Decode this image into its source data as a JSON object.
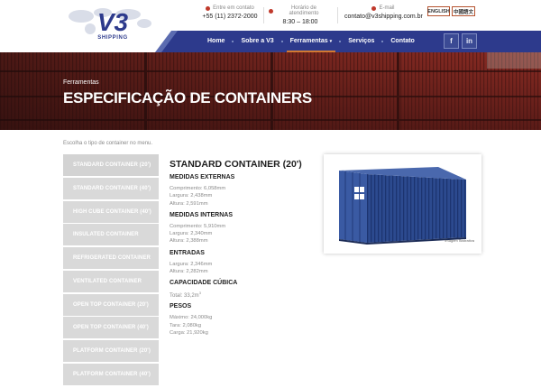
{
  "header": {
    "logo_text": "V3",
    "logo_subtext": "SHIPPING",
    "contact": {
      "label": "Entre em contato",
      "value": "+55 (11) 2372-2000"
    },
    "hours": {
      "label": "Horário de atendimento",
      "value": "8:30 – 18:00"
    },
    "email": {
      "label": "E-mail",
      "value": "contato@v3shipping.com.br"
    },
    "languages": [
      "ENGLISH",
      "中國語文"
    ]
  },
  "nav": {
    "items": [
      "Home",
      "Sobre a V3",
      "Ferramentas",
      "Serviços",
      "Contato"
    ],
    "active_index": 2,
    "dropdown_indicator": "▾",
    "social": [
      "f",
      "in"
    ]
  },
  "hero": {
    "breadcrumb": "Ferramentas",
    "title": "ESPECIFICAÇÃO DE CONTAINERS"
  },
  "intro": "Escolha o tipo de container no menu.",
  "sidebar": {
    "items": [
      "STANDARD CONTAINER (20')",
      "STANDARD CONTAINER (40')",
      "HIGH CUBE CONTAINER (40')",
      "INSULATED CONTAINER",
      "REFRIGERATED CONTAINER",
      "VENTILATED CONTAINER",
      "OPEN TOP CONTAINER (20')",
      "OPEN TOP CONTAINER (40')",
      "PLATFORM CONTAINER (20')",
      "PLATFORM CONTAINER (40')"
    ]
  },
  "spec": {
    "title": "STANDARD CONTAINER (20')",
    "external": {
      "heading": "MEDIDAS EXTERNAS",
      "lines": [
        "Comprimento: 6,058mm",
        "Largura: 2,438mm",
        "Altura: 2,591mm"
      ]
    },
    "internal": {
      "heading": "MEDIDAS INTERNAS",
      "lines": [
        "Comprimento: 5,910mm",
        "Largura: 2,340mm",
        "Altura: 2,388mm"
      ]
    },
    "entries": {
      "heading": "ENTRADAS",
      "lines": [
        "Largura: 2,346mm",
        "Altura: 2,282mm"
      ]
    },
    "capacity": {
      "heading": "CAPACIDADE CÚBICA",
      "value": "Total: 33,2m",
      "unit_sup": "3"
    },
    "weights": {
      "heading": "PESOS",
      "lines": [
        "Máximo: 24,000kg",
        "Tara: 2,080kg",
        "Carga: 21,920kg"
      ]
    }
  },
  "image": {
    "caption": "Imagem Ilustrativa"
  },
  "colors": {
    "nav_blue": "#2d3a8c",
    "accent_orange": "#d27a33",
    "sidebar_gray": "#d9d9d9",
    "container_blue": "#2c4a8f"
  }
}
